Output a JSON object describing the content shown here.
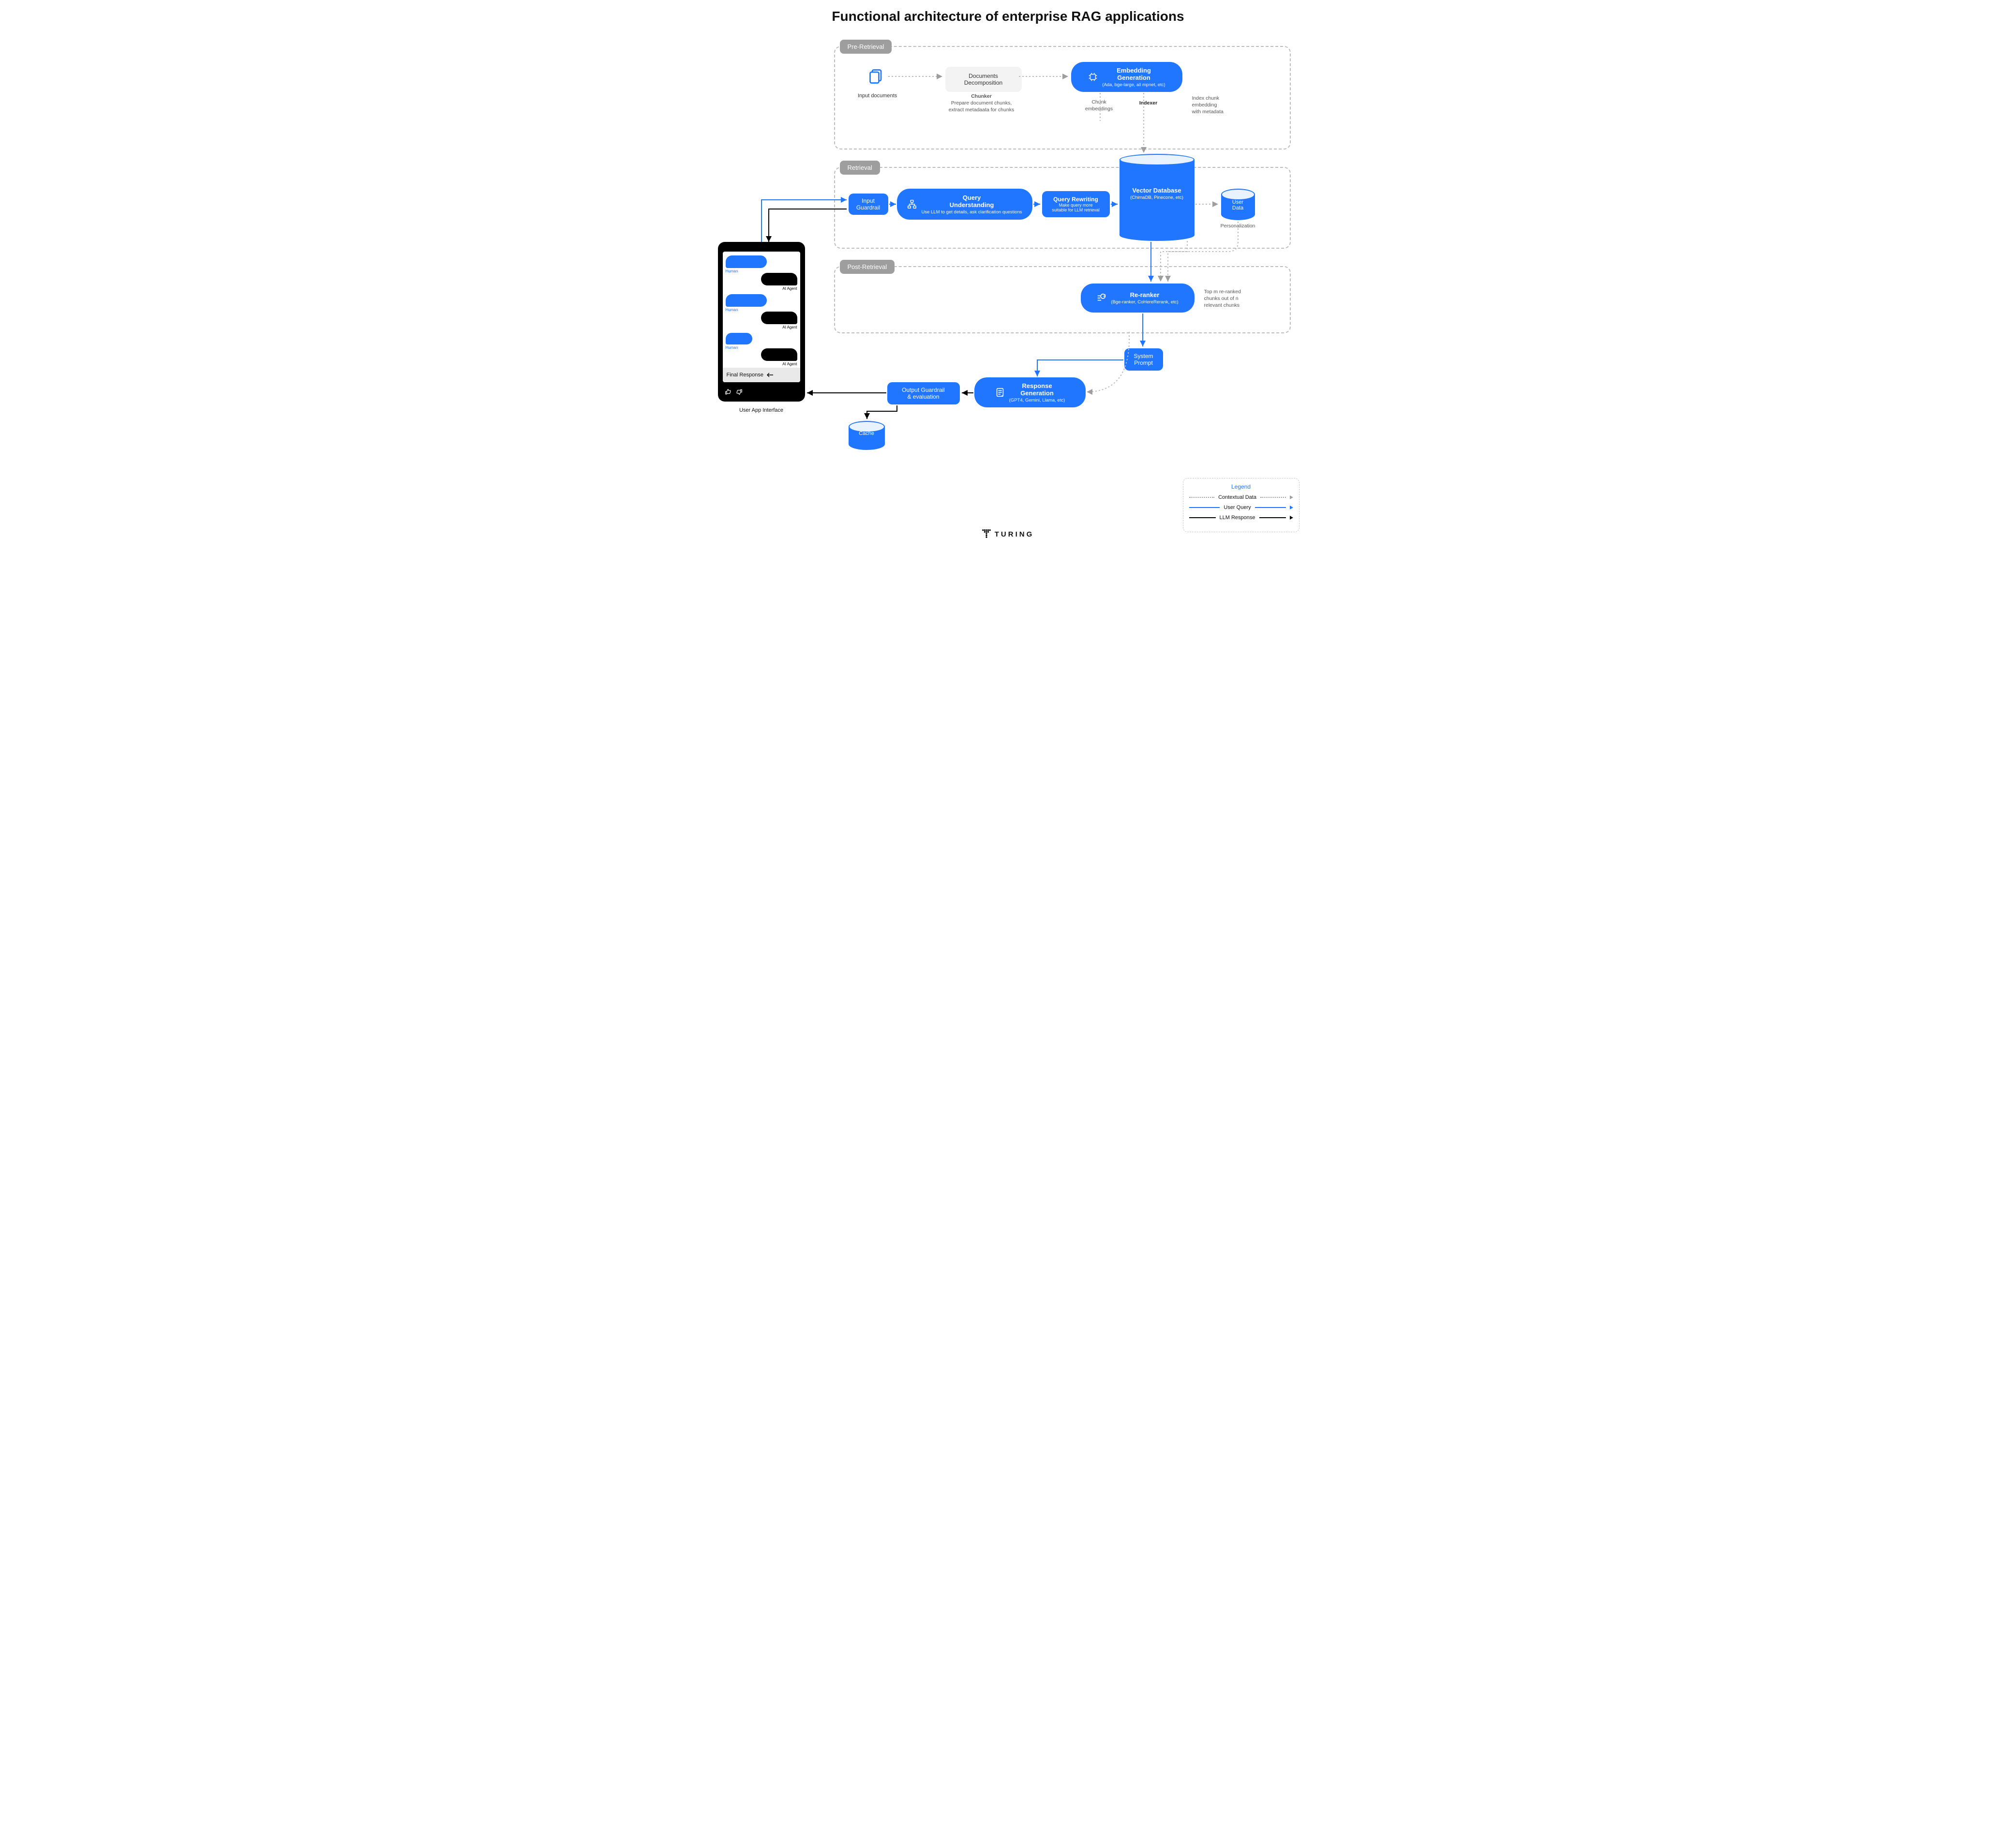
{
  "title": "Functional architecture of enterprise RAG applications",
  "phases": {
    "pre": "Pre-Retrieval",
    "ret": "Retrieval",
    "post": "Post-Retrieval"
  },
  "pre": {
    "input_docs": "Input documents",
    "decomp": "Documents\nDecomposition",
    "chunker_t": "Chunker",
    "chunker_d": "Prepare document chunks,\nextract metadaata for chunks",
    "embed_t": "Embedding\nGeneration",
    "embed_d": "(Ada, bge-large, all mpnet, etc)",
    "chunk_emb": "Chunk\nembeddings",
    "indexer": "Indexer",
    "index_note": "Index chunk\nembedding\nwith metadata"
  },
  "ret": {
    "input_guard": "Input\nGuardrail",
    "qu_t": "Query\nUnderstanding",
    "qu_d": "Use LLM to get details, ask clarification questions",
    "qr_t": "Query Rewriting",
    "qr_d": "Make query more\nsuitable for LLM retrieval",
    "vdb_t": "Vector Database",
    "vdb_d": "(ChimaDB, Pinecone, etc)",
    "user_data": "User\nData",
    "personalization": "Personalization"
  },
  "post": {
    "rerank_t": "Re-ranker",
    "rerank_d": "(Bge-ranker, CoHereRerank, etc)",
    "rerank_note": "Top m re-ranked\nchunks out of n\nrelevant chunks",
    "sys_prompt": "System\nPrompt",
    "resp_t": "Response\nGeneration",
    "resp_d": "(GPT4, Gemini, Llama, etc)",
    "out_guard": "Output Guardrail\n& evaluation",
    "cache": "Cache"
  },
  "phone": {
    "human": "Human",
    "agent": "AI Agent",
    "final": "Final Response",
    "caption": "User App Interface"
  },
  "legend": {
    "title": "Legend",
    "ctx": "Contextual Data",
    "uq": "User Query",
    "llm": "LLM Response"
  },
  "brand": "TURING"
}
